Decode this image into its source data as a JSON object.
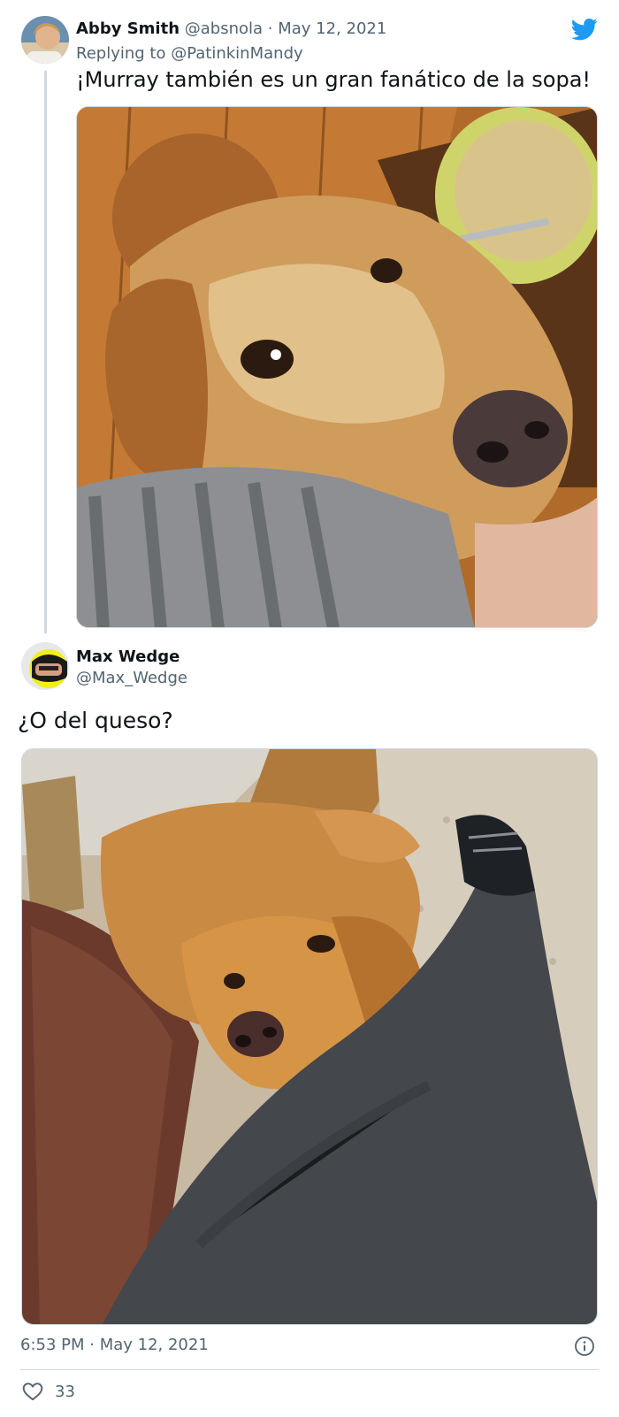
{
  "reply": {
    "author_name": "Abby Smith",
    "author_handle": "@absnola",
    "separator": "·",
    "date": "May 12, 2021",
    "replying_prefix": "Replying to",
    "replying_to": "@PatinkinMandy",
    "text": "¡Murray también es un gran fanático de la sopa!"
  },
  "main": {
    "author_name": "Max Wedge",
    "author_handle": "@Max_Wedge",
    "text": "¿O del queso?",
    "timestamp": "6:53 PM · May 12, 2021",
    "like_count": "33"
  },
  "icons": {
    "brand": "twitter-bird-icon",
    "info": "info-icon",
    "like": "heart-icon"
  },
  "colors": {
    "twitter_blue": "#1d9bf0",
    "muted_text": "#536471",
    "primary_text": "#0f1419",
    "divider": "#cfd9de"
  }
}
